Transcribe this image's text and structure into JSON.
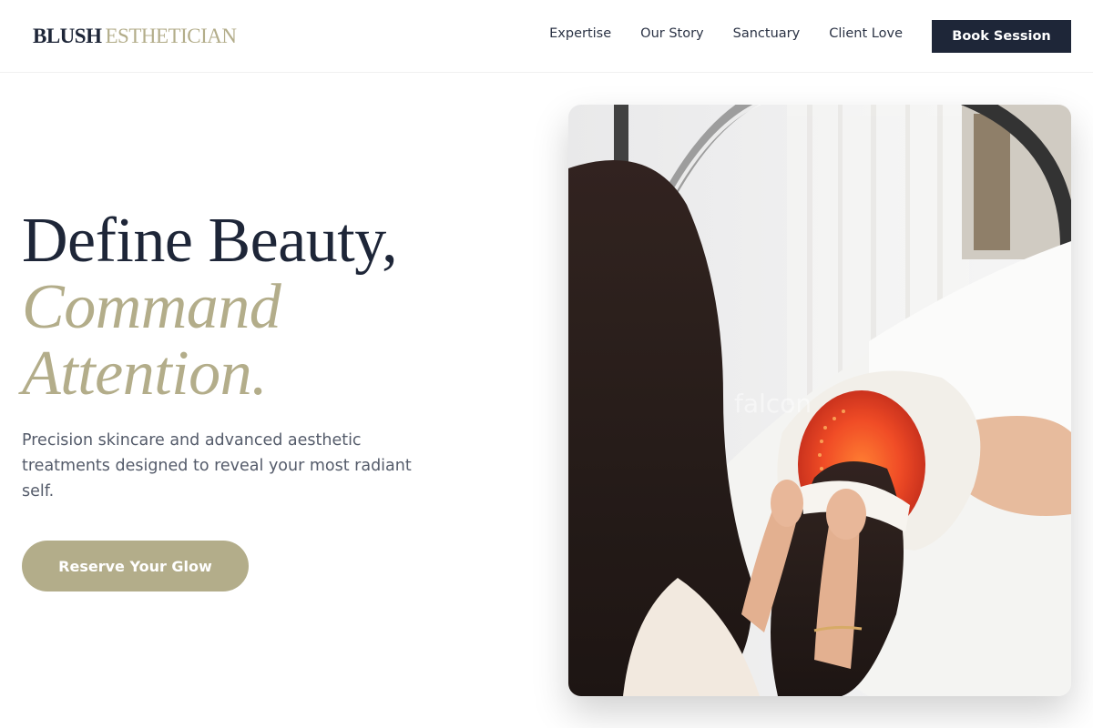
{
  "header": {
    "logo_brand": "BLUSH",
    "logo_tag": "ESTHETICIAN",
    "nav": [
      {
        "label": "Expertise"
      },
      {
        "label": "Our Story"
      },
      {
        "label": "Sanctuary"
      },
      {
        "label": "Client Love"
      }
    ],
    "cta_label": "Book Session"
  },
  "hero": {
    "headline_line1": "Define Beauty,",
    "headline_line2": "Command",
    "headline_line3": "Attention.",
    "subtext": "Precision skincare and advanced aesthetic treatments designed to reveal your most radiant self.",
    "cta_label": "Reserve Your Glow",
    "image_icon": "led-light-therapy-photo",
    "watermark": "falcon"
  },
  "colors": {
    "navy": "#1e2638",
    "gold": "#b3ad8a",
    "text_muted": "#545b6a"
  }
}
